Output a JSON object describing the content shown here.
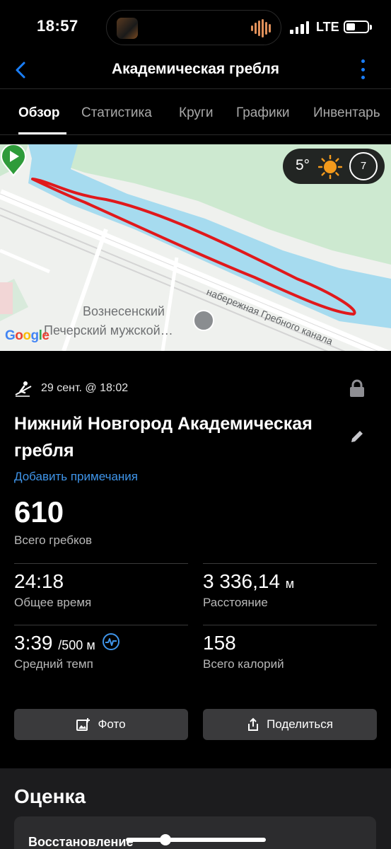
{
  "status_bar": {
    "time": "18:57",
    "network": "LTE"
  },
  "nav": {
    "title": "Академическая гребля"
  },
  "tabs": [
    {
      "label": "Обзор",
      "active": true
    },
    {
      "label": "Статистика",
      "active": false
    },
    {
      "label": "Круги",
      "active": false
    },
    {
      "label": "Графики",
      "active": false
    },
    {
      "label": "Инвентарь",
      "active": false
    }
  ],
  "map": {
    "weather_temp": "5°",
    "wind_value": "7",
    "poi_label_line1": "Вознесенский",
    "poi_label_line2": "Печерский мужской…",
    "street_label": "набережная Гребного канала",
    "attribution": "Google",
    "route_color": "#e0191c",
    "water_color": "#a6dbef",
    "park_color": "#cde9d0"
  },
  "activity": {
    "date": "29 сент. @ 18:02",
    "title": "Нижний Новгород Академическая гребля",
    "add_notes": "Добавить примечания",
    "total_strokes_value": "610",
    "total_strokes_label": "Всего гребков"
  },
  "stats": {
    "total_time": {
      "value": "24:18",
      "label": "Общее время"
    },
    "distance": {
      "value": "3 336,14",
      "unit": "м",
      "label": "Расстояние"
    },
    "avg_pace": {
      "value": "3:39",
      "unit": "/500 м",
      "label": "Средний темп"
    },
    "calories": {
      "value": "158",
      "label": "Всего калорий"
    }
  },
  "buttons": {
    "photo": "Фото",
    "share": "Поделиться"
  },
  "rating": {
    "heading": "Оценка",
    "recovery_label": "Восстановление"
  },
  "colors": {
    "accent": "#3f95ea",
    "nav_accent": "#1a7fff"
  }
}
